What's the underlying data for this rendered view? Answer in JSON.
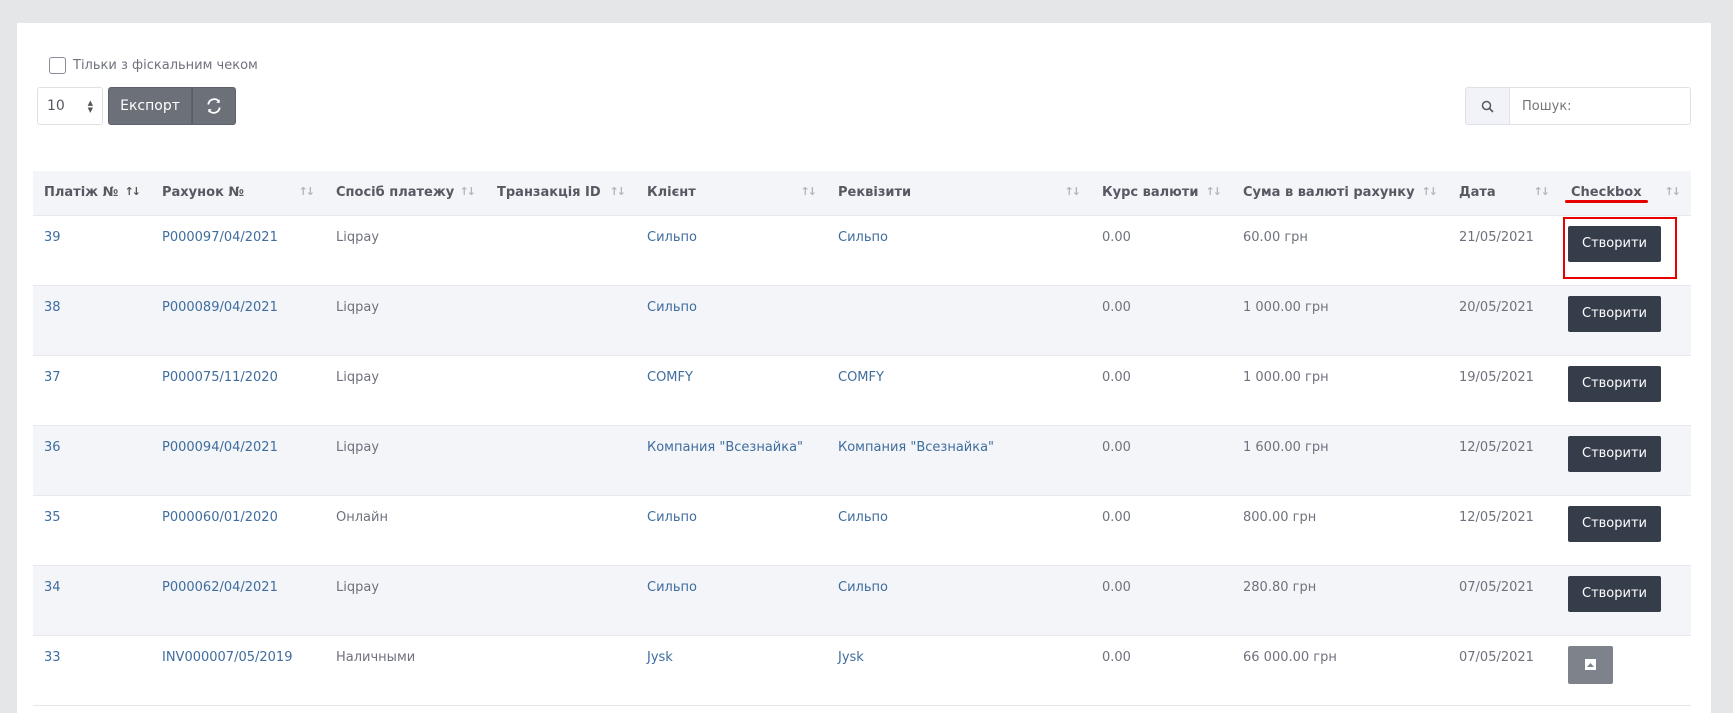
{
  "filters": {
    "fiscal_only_label": "Тільки з фіскальним чеком",
    "page_length": "10",
    "export_label": "Експорт",
    "search_placeholder": "Пошук:"
  },
  "table": {
    "columns": [
      "Платіж №",
      "Рахунок №",
      "Спосіб платежу",
      "Транзакція ID",
      "Клієнт",
      "Реквізити",
      "Курс валюти",
      "Сума в валюті рахунку",
      "Дата",
      "Checkbox"
    ],
    "create_label": "Створити",
    "rows": [
      {
        "payment": "39",
        "invoice": "P000097/04/2021",
        "method": "Liqpay",
        "transaction": "",
        "client": "Сильпо",
        "details": "Сильпо",
        "rate": "0.00",
        "amount": "60.00 грн",
        "date": "21/05/2021",
        "action": "create"
      },
      {
        "payment": "38",
        "invoice": "P000089/04/2021",
        "method": "Liqpay",
        "transaction": "",
        "client": "Сильпо",
        "details": "",
        "rate": "0.00",
        "amount": "1 000.00 грн",
        "date": "20/05/2021",
        "action": "create"
      },
      {
        "payment": "37",
        "invoice": "P000075/11/2020",
        "method": "Liqpay",
        "transaction": "",
        "client": "COMFY",
        "details": "COMFY",
        "rate": "0.00",
        "amount": "1 000.00 грн",
        "date": "19/05/2021",
        "action": "create"
      },
      {
        "payment": "36",
        "invoice": "P000094/04/2021",
        "method": "Liqpay",
        "transaction": "",
        "client": "Компания \"Всезнайка\"",
        "details": "Компания \"Всезнайка\"",
        "rate": "0.00",
        "amount": "1 600.00 грн",
        "date": "12/05/2021",
        "action": "create"
      },
      {
        "payment": "35",
        "invoice": "P000060/01/2020",
        "method": "Онлайн",
        "transaction": "",
        "client": "Сильпо",
        "details": "Сильпо",
        "rate": "0.00",
        "amount": "800.00 грн",
        "date": "12/05/2021",
        "action": "create"
      },
      {
        "payment": "34",
        "invoice": "P000062/04/2021",
        "method": "Liqpay",
        "transaction": "",
        "client": "Сильпо",
        "details": "Сильпо",
        "rate": "0.00",
        "amount": "280.80 грн",
        "date": "07/05/2021",
        "action": "create"
      },
      {
        "payment": "33",
        "invoice": "INV000007/05/2019",
        "method": "Наличными",
        "transaction": "",
        "client": "Jysk",
        "details": "Jysk",
        "rate": "0.00",
        "amount": "66 000.00 грн",
        "date": "07/05/2021",
        "action": "pdf"
      }
    ]
  },
  "colors": {
    "header_bg": "#f3f5f8",
    "link": "#3f6d9e",
    "button_dark": "#363d4a",
    "annotation_red": "#e60000"
  }
}
